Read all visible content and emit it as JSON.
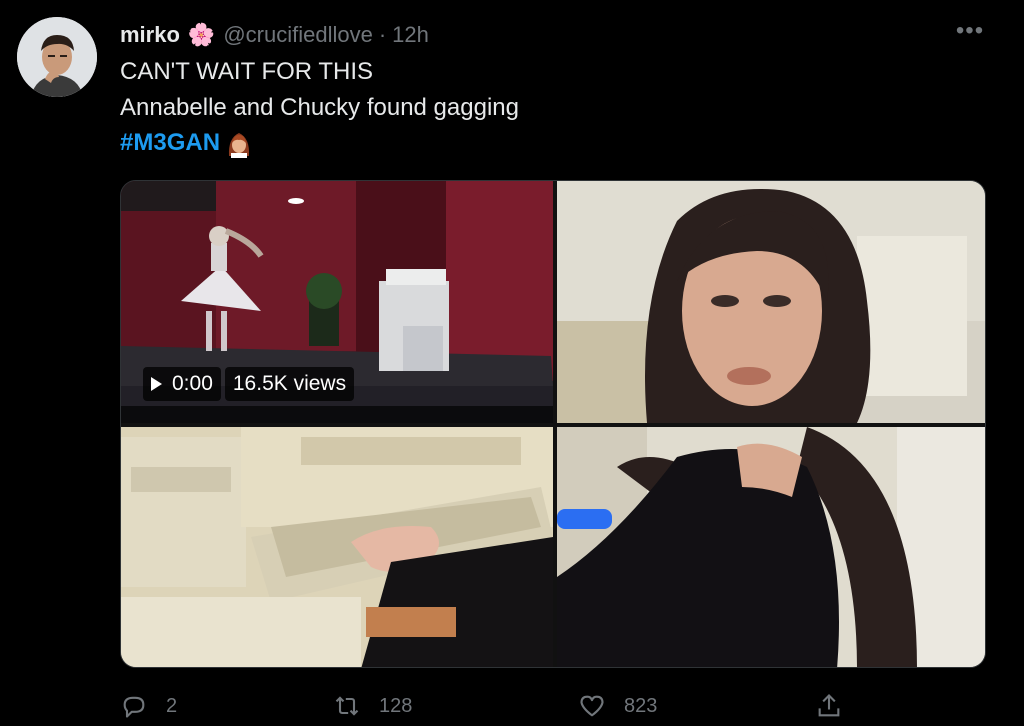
{
  "tweet": {
    "author_name": "mirko",
    "author_emoji": "🌸",
    "handle": "@crucifiedllove",
    "separator": "·",
    "time": "12h",
    "more_label": "•••",
    "lines": [
      "CAN'T WAIT FOR THIS",
      "Annabelle and Chucky found gagging"
    ],
    "hashtag": "#M3GAN"
  },
  "video": {
    "duration": "0:00",
    "views": "16.5K views"
  },
  "actions": {
    "replies": "2",
    "retweets": "128",
    "likes": "823"
  },
  "icons": {
    "reply": "reply-icon",
    "retweet": "retweet-icon",
    "like": "heart-icon",
    "share": "share-icon",
    "play": "play-icon",
    "more": "more-icon"
  },
  "colors": {
    "background": "#000000",
    "text": "#e7e9ea",
    "muted": "#71767b",
    "link": "#1d9bf0"
  }
}
